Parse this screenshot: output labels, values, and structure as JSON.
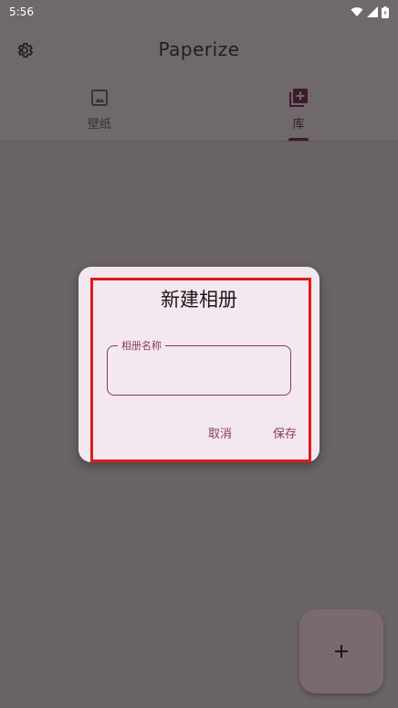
{
  "status_bar": {
    "time": "5:56"
  },
  "app_bar": {
    "title": "Paperize"
  },
  "tabs": [
    {
      "label": "壁纸",
      "icon": "image-icon",
      "active": false
    },
    {
      "label": "库",
      "icon": "library-add-icon",
      "active": true
    }
  ],
  "dialog": {
    "title": "新建相册",
    "field_label": "相册名称",
    "field_value": "",
    "cancel_label": "取消",
    "save_label": "保存"
  },
  "fab": {
    "icon": "plus-icon"
  },
  "colors": {
    "scrim": "#6a6466",
    "dialog_bg": "#f3e8ef",
    "accent": "#8a3a5e",
    "highlight": "#e01919"
  }
}
